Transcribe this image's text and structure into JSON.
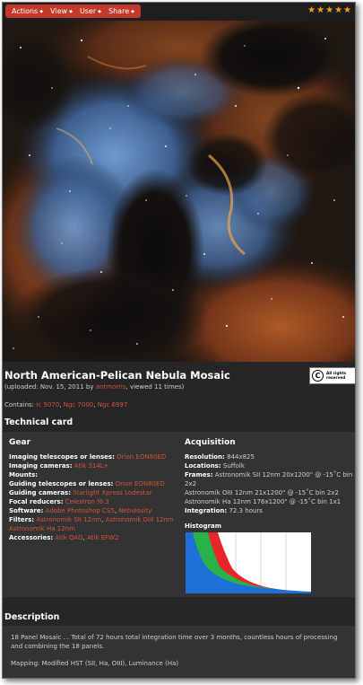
{
  "menu": [
    "Actions",
    "View",
    "User",
    "Share"
  ],
  "rating": {
    "stars": 5,
    "max": 5
  },
  "title": "North American-Pelican Nebula Mosaic",
  "subtitle": {
    "prefix": "(uploaded: Nov. 15, 2011 by",
    "user": "antmorris",
    "suffix": ", viewed 11 times)"
  },
  "license": {
    "symbol": "C",
    "text_line1": "All rights",
    "text_line2": "reserved"
  },
  "contains": {
    "label": "Contains:",
    "items": [
      "Ic 5070",
      "Ngc 7000",
      "Ngc 6997"
    ]
  },
  "technical_card": {
    "heading": "Technical card",
    "gear": {
      "heading": "Gear",
      "imaging_telescopes": {
        "label": "Imaging telescopes or lenses:",
        "value": "Orion EON80ED"
      },
      "imaging_cameras": {
        "label": "Imaging cameras:",
        "value": "Atik 314L+"
      },
      "mounts": {
        "label": "Mounts:"
      },
      "guiding_telescopes": {
        "label": "Guiding telescopes or lenses:",
        "value": "Orion EON80ED"
      },
      "guiding_cameras": {
        "label": "Guiding cameras:",
        "value": "Starlight Xpress Lodestar"
      },
      "focal_reducers": {
        "label": "Focal reducers:",
        "value": "Celestron f6.3"
      },
      "software": {
        "label": "Software:",
        "values": [
          "Adobe Photoshop CS5",
          "Nebulosity"
        ]
      },
      "filters": {
        "label": "Filters:",
        "values": [
          "Astronomik SII 12nm",
          "Astronomik OIII 12nm",
          "Astronomik Ha 12nm"
        ]
      },
      "accessories": {
        "label": "Accessories:",
        "values": [
          "Atik OAG",
          "Atik EFW2"
        ]
      }
    },
    "acquisition": {
      "heading": "Acquisition",
      "resolution": {
        "label": "Resolution:",
        "value": "844x825"
      },
      "locations": {
        "label": "Locations:",
        "value": "Suffolk"
      },
      "frames": {
        "label": "Frames:",
        "line1": "Astronomik SII 12nm 20x1200\" @ -15˚C bin",
        "line1b": "2x2",
        "line2": "Astronomik OIII 12nm 21x1200\" @ -15˚C bin 2x2",
        "line3": "Astronomik Ha 12nm 176x1200\" @ -15˚C bin 1x1"
      },
      "integration": {
        "label": "Integration:",
        "value": "72.3 hours"
      },
      "histogram_label": "Histogram"
    }
  },
  "description": {
    "heading": "Description",
    "para1_line1": "18 Panel Mosaic ... Total of 72 hours total integration time over 3 months, countless hours of processing",
    "para1_line2": "and combining the 18 panels.",
    "para2": "Mapping: Modified HST (SII, Ha, OIII), Luminance (Ha)"
  },
  "colors": {
    "accent": "#c0392b",
    "link": "#d55339",
    "star": "#f3a21b",
    "panel": "#333333",
    "background": "#262626"
  },
  "histogram": {
    "blue_fraction": 1.0,
    "green_fraction": 0.85,
    "red_fraction": 0.72
  }
}
